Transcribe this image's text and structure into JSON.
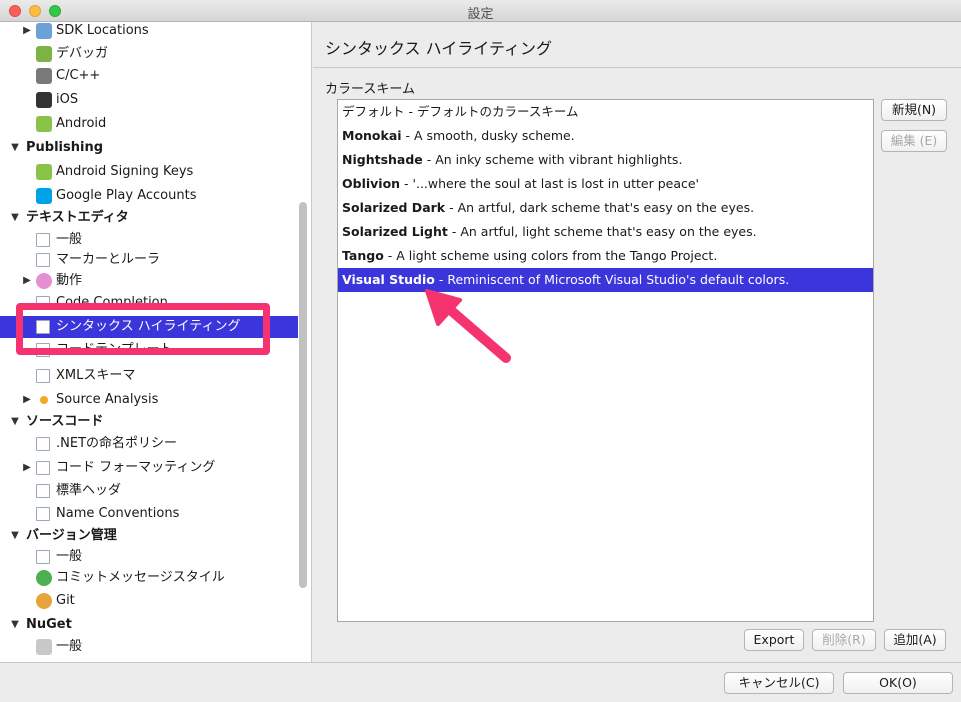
{
  "window": {
    "title": "設定"
  },
  "sidebar": {
    "items": [
      {
        "label": "SDK Locations",
        "icon": "folder-icon",
        "color": "#6aa2d8"
      },
      {
        "label": "デバッガ",
        "icon": "bug-icon",
        "color": "#7cb342"
      },
      {
        "label": "C/C++",
        "icon": "gear-icon",
        "color": "#7a7a7a"
      },
      {
        "label": "iOS",
        "icon": "phone-icon",
        "color": "#333333"
      },
      {
        "label": "Android",
        "icon": "android-icon",
        "color": "#8bc34a"
      },
      {
        "label": "Publishing"
      },
      {
        "label": "Android Signing Keys",
        "icon": "key-icon",
        "color": "#8bc34a"
      },
      {
        "label": "Google Play Accounts",
        "icon": "play-store-icon",
        "color": "#00a2e8"
      },
      {
        "label": "テキストエディタ"
      },
      {
        "label": "一般",
        "icon": "settings-doc-icon",
        "color": "#9aa8b8"
      },
      {
        "label": "マーカーとルーラ",
        "icon": "ruler-doc-icon",
        "color": "#9aa8b8"
      },
      {
        "label": "動作",
        "icon": "brain-icon",
        "color": "#e58fd3"
      },
      {
        "label": "Code Completion",
        "icon": "completion-doc-icon",
        "color": "#9aa8b8"
      },
      {
        "label": "シンタックス ハイライティング",
        "icon": "syntax-doc-icon",
        "color": "#ffffff"
      },
      {
        "label": "コードテンプレート",
        "icon": "template-doc-icon",
        "color": "#9aa8b8"
      },
      {
        "label": "XMLスキーマ",
        "icon": "xml-icon",
        "color": "#9aa8b8"
      },
      {
        "label": "Source Analysis",
        "icon": "dot-icon",
        "color": "#f5a623"
      },
      {
        "label": "ソースコード"
      },
      {
        "label": ".NETの命名ポリシー",
        "icon": "naming-icon",
        "color": "#9aa8b8"
      },
      {
        "label": "コード フォーマッティング",
        "icon": "format-doc-icon",
        "color": "#9aa8b8"
      },
      {
        "label": "標準ヘッダ",
        "icon": "header-doc-icon",
        "color": "#9aa8b8"
      },
      {
        "label": "Name Conventions",
        "icon": "name-conv-icon",
        "color": "#9aa8b8"
      },
      {
        "label": "バージョン管理"
      },
      {
        "label": "一般",
        "icon": "vc-general-icon",
        "color": "#9aa8b8"
      },
      {
        "label": "コミットメッセージスタイル",
        "icon": "check-circle-icon",
        "color": "#4caf50"
      },
      {
        "label": "Git",
        "icon": "git-icon",
        "color": "#e8a33d"
      },
      {
        "label": "NuGet"
      },
      {
        "label": "一般",
        "icon": "nuget-icon",
        "color": "#c8c8c8"
      }
    ]
  },
  "main": {
    "title": "シンタックス ハイライティング",
    "color_scheme_label": "カラースキーム",
    "schemes": [
      {
        "name": "デフォルト",
        "desc": " - デフォルトのカラースキーム",
        "bold": false
      },
      {
        "name": "Monokai",
        "desc": " - A smooth, dusky scheme.",
        "bold": true
      },
      {
        "name": "Nightshade",
        "desc": " - An inky scheme with vibrant highlights.",
        "bold": true
      },
      {
        "name": "Oblivion",
        "desc": " - '...where the soul at last is lost in utter peace'",
        "bold": true
      },
      {
        "name": "Solarized Dark",
        "desc": " - An artful, dark scheme that's easy on the eyes.",
        "bold": true
      },
      {
        "name": "Solarized Light",
        "desc": " - An artful, light scheme that's easy on the eyes.",
        "bold": true
      },
      {
        "name": "Tango",
        "desc": " - A light scheme using colors from the Tango Project.",
        "bold": true
      },
      {
        "name": "Visual Studio",
        "desc": " - Reminiscent of Microsoft Visual Studio's default colors.",
        "bold": true
      }
    ],
    "buttons": {
      "new": "新規(N)",
      "edit": "編集 (E)",
      "export": "Export",
      "delete": "削除(R)",
      "add": "追加(A)"
    }
  },
  "footer": {
    "cancel": "キャンセル(C)",
    "ok": "OK(O)"
  },
  "colors": {
    "accent": "#3b36dc",
    "highlight": "#f5336e"
  }
}
